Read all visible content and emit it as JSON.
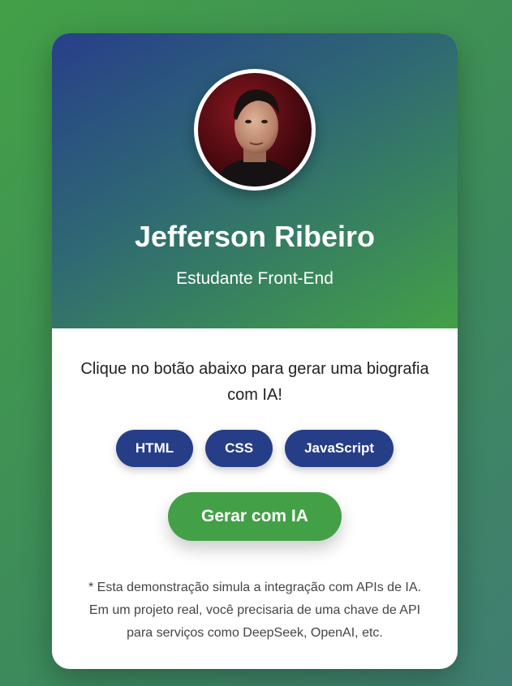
{
  "profile": {
    "name": "Jefferson Ribeiro",
    "role": "Estudante Front-End"
  },
  "intro": "Clique no botão abaixo para gerar uma biografia com IA!",
  "tags": [
    "HTML",
    "CSS",
    "JavaScript"
  ],
  "generate_button": "Gerar com IA",
  "note": {
    "line1": "* Esta demonstração simula a integração com APIs de IA.",
    "line2": "Em um projeto real, você precisaria de uma chave de API",
    "line3": "para serviços como DeepSeek, OpenAI, etc."
  },
  "colors": {
    "primary": "#263d87",
    "accent": "#43a047",
    "card": "#ffffff"
  }
}
